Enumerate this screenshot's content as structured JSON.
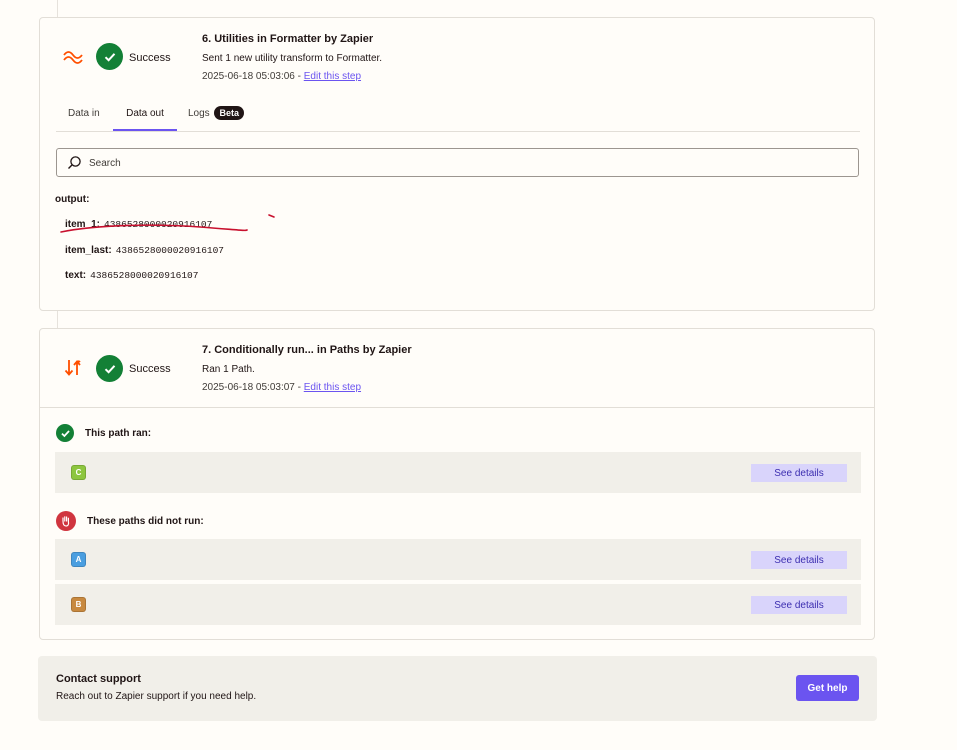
{
  "step6": {
    "title": "6. Utilities in Formatter by Zapier",
    "description": "Sent 1 new utility transform to Formatter.",
    "timestamp": "2025-06-18 05:03:06",
    "separator": " - ",
    "edit_link": "Edit this step",
    "status": "Success",
    "app_icon": "formatter-wave-icon",
    "tabs": [
      {
        "label": "Data in"
      },
      {
        "label": "Data out"
      },
      {
        "label": "Logs",
        "badge": "Beta"
      }
    ],
    "search_placeholder": "Search",
    "output_label": "output:",
    "output": [
      {
        "key": "item_1:",
        "value": "4386528000020916107"
      },
      {
        "key": "item_last:",
        "value": "4386528000020916107"
      },
      {
        "key": "text:",
        "value": "4386528000020916107"
      }
    ]
  },
  "step7": {
    "title": "7. Conditionally run... in Paths by Zapier",
    "description": "Ran 1 Path.",
    "timestamp": "2025-06-18 05:03:07",
    "separator": " - ",
    "edit_link": "Edit this step",
    "status": "Success",
    "app_icon": "paths-split-icon",
    "ran_header": "This path ran:",
    "not_ran_header": "These paths did not run:",
    "paths_ran": [
      {
        "letter": "C",
        "color": "#8dc63f",
        "action": "See details"
      }
    ],
    "paths_not_ran": [
      {
        "letter": "A",
        "color": "#4a9ee0",
        "action": "See details"
      },
      {
        "letter": "B",
        "color": "#c8893f",
        "action": "See details"
      }
    ]
  },
  "support": {
    "title": "Contact support",
    "description": "Reach out to Zapier support if you need help.",
    "button": "Get help"
  },
  "colors": {
    "accent": "#6b54f0",
    "success": "#138036",
    "error": "#d0353f",
    "brand_orange": "#ff4f00",
    "annotation_red": "#c8102e"
  }
}
